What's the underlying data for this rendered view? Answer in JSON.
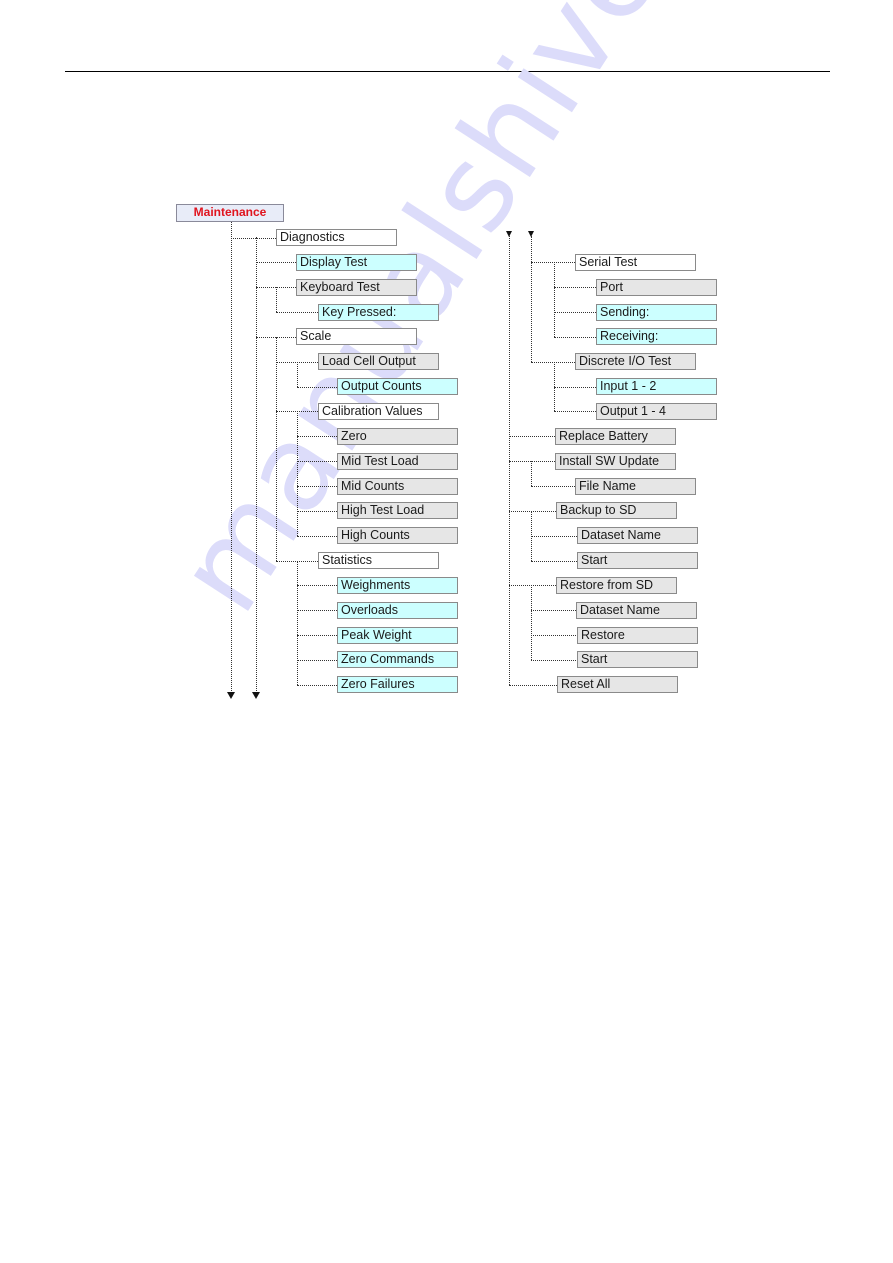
{
  "document": {
    "watermark": "manualshive.com"
  },
  "diagram": {
    "title": "Maintenance",
    "colors": {
      "root_text": "#e0141e",
      "root_fill": "#e8ecf8",
      "branch_fill": "#ffffff",
      "setting_fill": "#e6e6e6",
      "display_fill": "#ccffff",
      "border": "#8a8a8a"
    },
    "left_column": [
      {
        "label": "Diagnostics",
        "type": "white",
        "level": 1
      },
      {
        "label": "Display Test",
        "type": "cyan",
        "level": 2
      },
      {
        "label": "Keyboard Test",
        "type": "gray",
        "level": 2
      },
      {
        "label": "Key Pressed:",
        "type": "cyan",
        "level": 3
      },
      {
        "label": "Scale",
        "type": "white",
        "level": 2
      },
      {
        "label": "Load Cell Output",
        "type": "gray",
        "level": 3
      },
      {
        "label": "Output Counts",
        "type": "cyan",
        "level": 4
      },
      {
        "label": "Calibration Values",
        "type": "white",
        "level": 3
      },
      {
        "label": "Zero",
        "type": "gray",
        "level": 4
      },
      {
        "label": "Mid Test Load",
        "type": "gray",
        "level": 4
      },
      {
        "label": "Mid Counts",
        "type": "gray",
        "level": 4
      },
      {
        "label": "High Test Load",
        "type": "gray",
        "level": 4
      },
      {
        "label": "High Counts",
        "type": "gray",
        "level": 4
      },
      {
        "label": "Statistics",
        "type": "white",
        "level": 3
      },
      {
        "label": "Weighments",
        "type": "cyan",
        "level": 4
      },
      {
        "label": "Overloads",
        "type": "cyan",
        "level": 4
      },
      {
        "label": "Peak Weight",
        "type": "cyan",
        "level": 4
      },
      {
        "label": "Zero Commands",
        "type": "cyan",
        "level": 4
      },
      {
        "label": "Zero Failures",
        "type": "cyan",
        "level": 4
      }
    ],
    "right_column": [
      {
        "label": "Serial Test",
        "type": "white",
        "level": 2
      },
      {
        "label": "Port",
        "type": "gray",
        "level": 3
      },
      {
        "label": "Sending:",
        "type": "cyan",
        "level": 3
      },
      {
        "label": "Receiving:",
        "type": "cyan",
        "level": 3
      },
      {
        "label": "Discrete I/O Test",
        "type": "gray",
        "level": 2
      },
      {
        "label": "Input 1 - 2",
        "type": "cyan",
        "level": 3
      },
      {
        "label": "Output 1 - 4",
        "type": "gray",
        "level": 3
      },
      {
        "label": "Replace Battery",
        "type": "gray",
        "level": 1
      },
      {
        "label": "Install SW Update",
        "type": "gray",
        "level": 1
      },
      {
        "label": "File Name",
        "type": "gray",
        "level": 2
      },
      {
        "label": "Backup to SD",
        "type": "gray",
        "level": 1
      },
      {
        "label": "Dataset Name",
        "type": "gray",
        "level": 2
      },
      {
        "label": "Start",
        "type": "gray",
        "level": 2
      },
      {
        "label": "Restore from SD",
        "type": "gray",
        "level": 1
      },
      {
        "label": "Dataset Name",
        "type": "gray",
        "level": 2
      },
      {
        "label": "Restore",
        "type": "gray",
        "level": 2
      },
      {
        "label": "Start",
        "type": "gray",
        "level": 2
      },
      {
        "label": "Reset All",
        "type": "gray",
        "level": 1
      }
    ]
  }
}
